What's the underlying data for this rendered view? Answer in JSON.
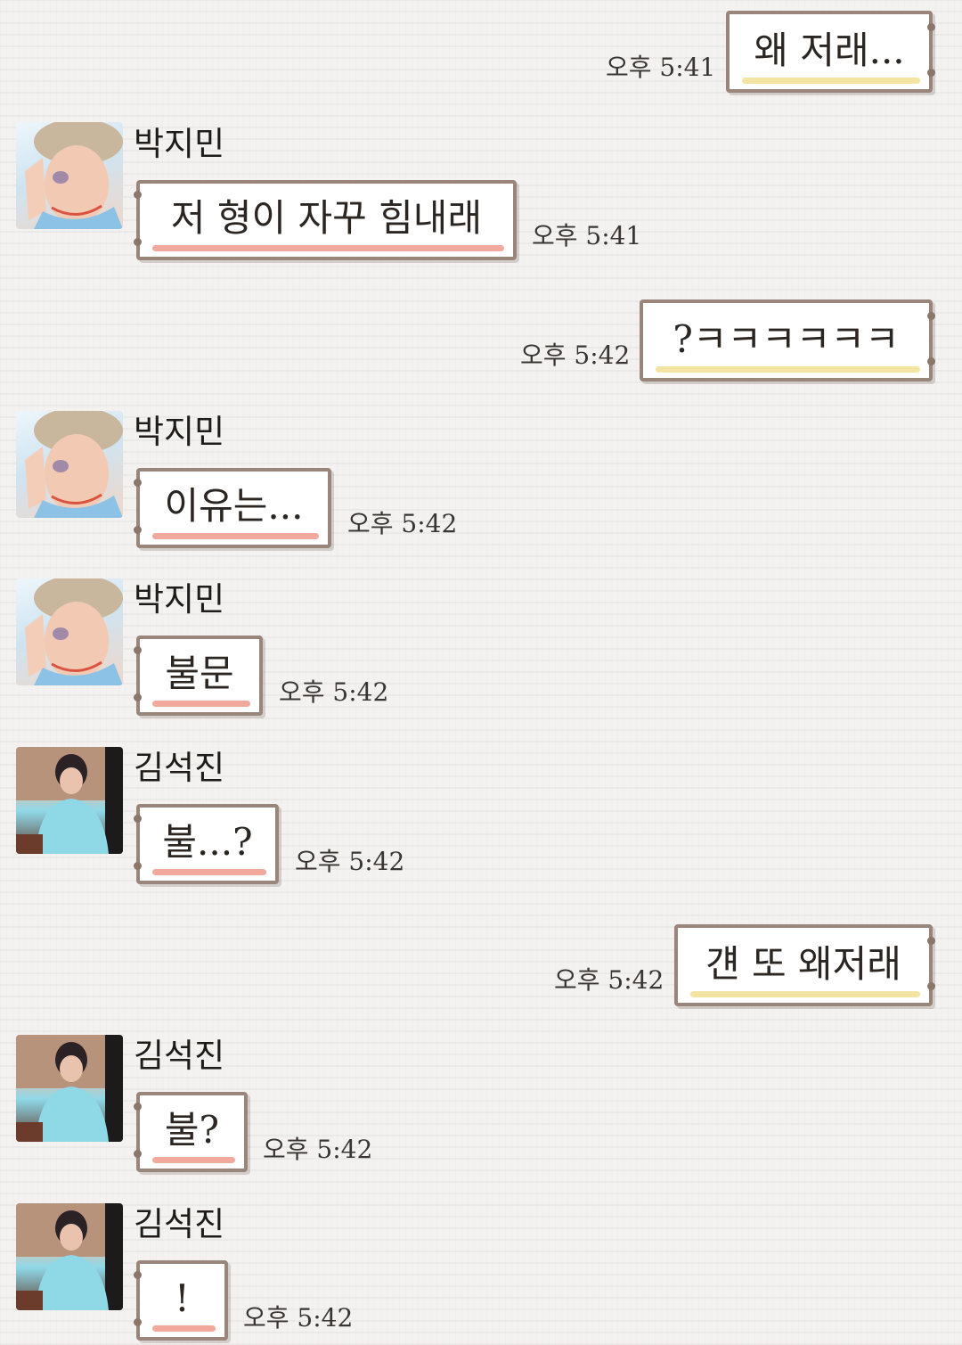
{
  "chat": {
    "messages": [
      {
        "dir": "out",
        "text": "왜 저래...",
        "time": "오후 5:41"
      },
      {
        "dir": "in",
        "sender": "박지민",
        "avatar": "jimin-avatar",
        "text": "저 형이 자꾸 힘내래",
        "time": "오후 5:41"
      },
      {
        "dir": "out",
        "text": "?ㅋㅋㅋㅋㅋㅋ",
        "time": "오후 5:42"
      },
      {
        "dir": "in",
        "sender": "박지민",
        "avatar": "jimin-avatar",
        "text": "이유는...",
        "time": "오후 5:42"
      },
      {
        "dir": "in",
        "sender": "박지민",
        "avatar": "jimin-avatar",
        "text": "불문",
        "time": "오후 5:42"
      },
      {
        "dir": "in",
        "sender": "김석진",
        "avatar": "jin-avatar",
        "text": "불...?",
        "time": "오후 5:42"
      },
      {
        "dir": "out",
        "text": "걘 또 왜저래",
        "time": "오후 5:42"
      },
      {
        "dir": "in",
        "sender": "김석진",
        "avatar": "jin-avatar",
        "text": "불?",
        "time": "오후 5:42"
      },
      {
        "dir": "in",
        "sender": "김석진",
        "avatar": "jin-avatar",
        "text": "!",
        "time": "오후 5:42"
      }
    ]
  },
  "colors": {
    "bubble_border": "#9a857a",
    "incoming_underline": "#f0a99c",
    "outgoing_underline": "#f4e4a1",
    "background": "#f3f2f0"
  }
}
